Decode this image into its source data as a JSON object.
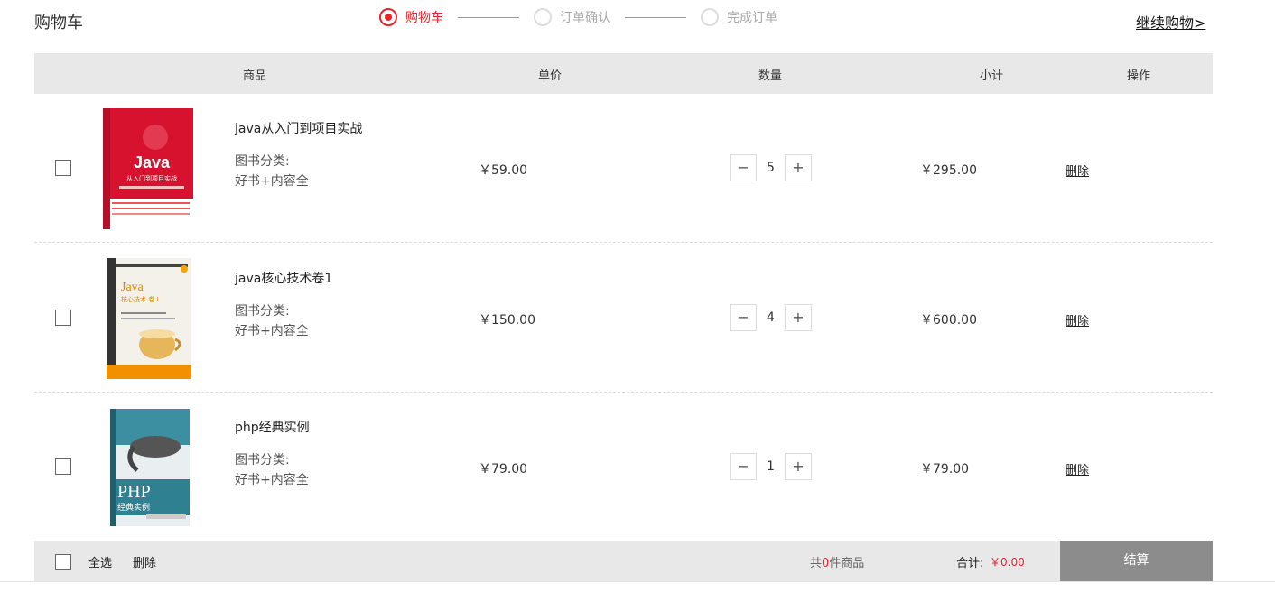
{
  "page": {
    "title": "购物车",
    "continue_link": "继续购物>"
  },
  "steps": [
    {
      "label": "购物车",
      "state": "active"
    },
    {
      "label": "订单确认",
      "state": "inactive"
    },
    {
      "label": "完成订单",
      "state": "inactive"
    }
  ],
  "table_header": {
    "product": "商品",
    "unit_price": "单价",
    "quantity": "数量",
    "subtotal": "小计",
    "action": "操作"
  },
  "items": [
    {
      "title": "java从入门到项目实战",
      "category_label": "图书分类:",
      "category_value": "好书+内容全",
      "price": "￥59.00",
      "minus": "−",
      "quantity": "5",
      "plus": "+",
      "subtotal": "￥295.00",
      "delete": "删除",
      "cover_text": [
        "Java",
        "从入门到项目实战"
      ]
    },
    {
      "title": "java核心技术卷1",
      "category_label": "图书分类:",
      "category_value": "好书+内容全",
      "price": "￥150.00",
      "minus": "−",
      "quantity": "4",
      "plus": "+",
      "subtotal": "￥600.00",
      "delete": "删除",
      "cover_text": [
        "Java",
        "核心技术 卷 I"
      ]
    },
    {
      "title": "php经典实例",
      "category_label": "图书分类:",
      "category_value": "好书+内容全",
      "price": "￥79.00",
      "minus": "−",
      "quantity": "1",
      "plus": "+",
      "subtotal": "￥79.00",
      "delete": "删除",
      "cover_text": [
        "PHP",
        "经典实例"
      ]
    }
  ],
  "footer": {
    "select_all": "全选",
    "delete": "删除",
    "count_prefix": "共",
    "count_value": "0",
    "count_suffix": "件商品",
    "total_label": "合计:",
    "total_value": "￥0.00",
    "checkout": "结算"
  },
  "colors": {
    "accent": "#e8242c",
    "header_bg": "#e8e8e8",
    "checkout_bg": "#8c8c8c"
  }
}
